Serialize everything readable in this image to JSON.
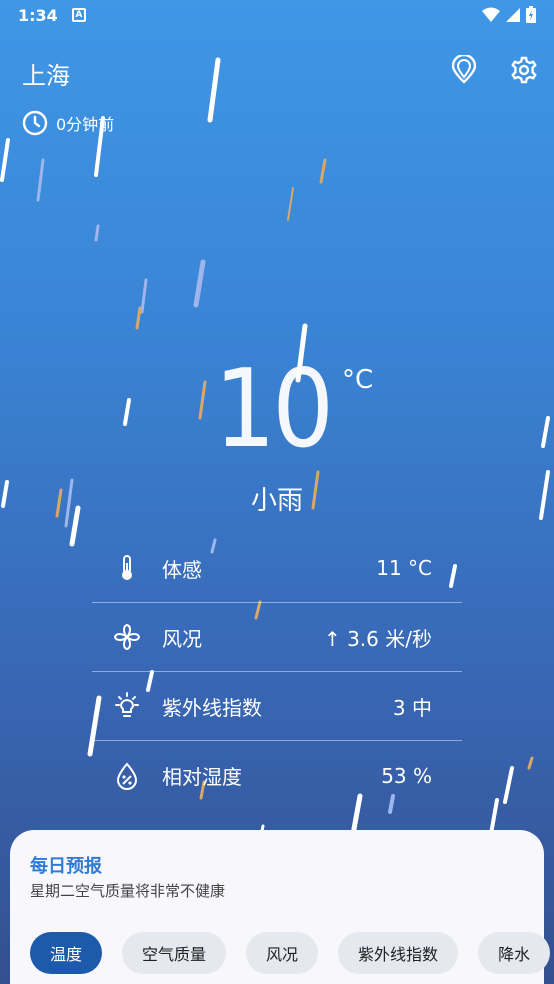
{
  "status_bar": {
    "time": "1:34",
    "notification_icon": "A"
  },
  "header": {
    "city": "上海",
    "updated": "0分钟前"
  },
  "current": {
    "temperature": "10",
    "unit": "°C",
    "condition": "小雨"
  },
  "details": [
    {
      "icon": "thermometer-icon",
      "label": "体感",
      "value": "11 °C"
    },
    {
      "icon": "fan-icon",
      "label": "风况",
      "value": "↑ 3.6 米/秒"
    },
    {
      "icon": "uv-bulb-icon",
      "label": "紫外线指数",
      "value": "3 中"
    },
    {
      "icon": "humidity-icon",
      "label": "相对湿度",
      "value": "53 %"
    }
  ],
  "forecast": {
    "title": "每日预报",
    "subtitle": "星期二空气质量将非常不健康",
    "tabs": [
      "温度",
      "空气质量",
      "风况",
      "紫外线指数",
      "降水"
    ],
    "active_tab": 0
  },
  "colors": {
    "accent": "#2f7bd6",
    "active_chip": "#1d5aab",
    "sheet": "#f8f8fc"
  }
}
